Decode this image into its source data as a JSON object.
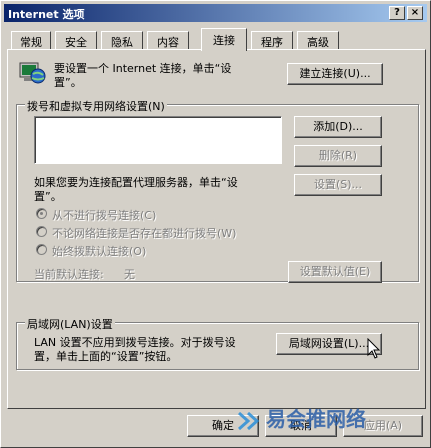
{
  "window": {
    "title": "Internet 选项",
    "help_label": "?",
    "close_label": "×"
  },
  "tabs": [
    {
      "label": "常规",
      "active": false
    },
    {
      "label": "安全",
      "active": false
    },
    {
      "label": "隐私",
      "active": false
    },
    {
      "label": "内容",
      "active": false
    },
    {
      "label": "连接",
      "active": true
    },
    {
      "label": "程序",
      "active": false
    },
    {
      "label": "高级",
      "active": false
    }
  ],
  "setup": {
    "line1": "要设置一个 Internet 连接，单击“设",
    "line2": "置”。",
    "button": "建立连接(U)..."
  },
  "dialup": {
    "legend": "拨号和虚拟专用网络设置(N)",
    "add_button": "添加(D)...",
    "remove_button": "删除(R)",
    "settings_button": "设置(S)...",
    "proxy_line1": "如果您要为连接配置代理服务器，单击“设",
    "proxy_line2": "置”。",
    "radio_never": "从不进行拨号连接(C)",
    "radio_no_network": "不论网络连接是否存在都进行拨号(W)",
    "radio_always": "始终拨默认连接(O)",
    "default_label": "当前默认连接:",
    "default_value": "无",
    "set_default_button": "设置默认值(E)"
  },
  "lan": {
    "legend": "局域网(LAN)设置",
    "line1": "LAN 设置不应用到拨号连接。对于拨号设",
    "line2": "置，单击上面的“设置”按钮。",
    "button": "局域网设置(L)..."
  },
  "footer": {
    "ok": "确定",
    "cancel": "取消",
    "apply": "应用(A)"
  },
  "watermark": "易会推网络"
}
